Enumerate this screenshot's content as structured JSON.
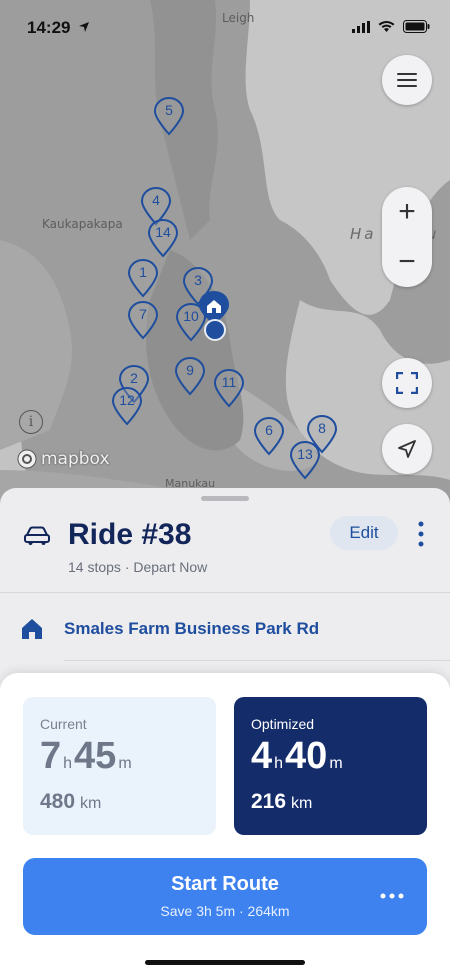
{
  "status_bar": {
    "time": "14:29"
  },
  "map": {
    "labels": {
      "leigh": "Leigh",
      "kaukapakapa": "Kaukapakapa",
      "hauraki": "Ha u    G u",
      "manukau": "Manukau"
    },
    "attribution": "mapbox",
    "info_glyph": "i",
    "stops": [
      "5",
      "4",
      "14",
      "1",
      "3",
      "7",
      "10",
      "2",
      "12",
      "9",
      "11",
      "6",
      "8",
      "13"
    ],
    "colors": {
      "pin": "#1f4e9e",
      "land": "#a3a3a3",
      "water": "#c2c2c2"
    }
  },
  "controls": {
    "zoom_in": "+",
    "zoom_out": "−"
  },
  "ride": {
    "title": "Ride #38",
    "subtitle": "14 stops · Depart Now",
    "edit_label": "Edit",
    "start_location": "Smales Farm Business Park Rd"
  },
  "comparison": {
    "current": {
      "label": "Current",
      "hours": "7",
      "hours_unit": "h",
      "minutes": "45",
      "minutes_unit": "m",
      "distance": "480",
      "distance_unit": "km"
    },
    "optimized": {
      "label": "Optimized",
      "hours": "4",
      "hours_unit": "h",
      "minutes": "40",
      "minutes_unit": "m",
      "distance": "216",
      "distance_unit": "km"
    }
  },
  "start_button": {
    "label": "Start Route",
    "savings": "Save 3h 5m · 264km"
  },
  "theme": {
    "accent": "#3d82ef",
    "navy": "#152c6b",
    "link": "#1f4e9e"
  }
}
